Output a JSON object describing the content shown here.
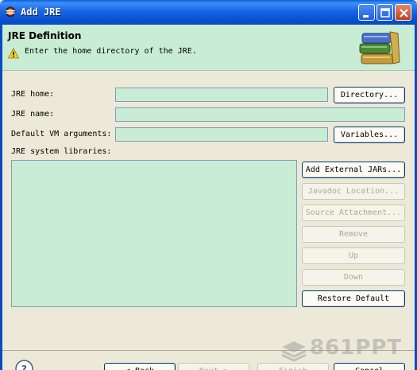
{
  "window": {
    "title": "Add JRE",
    "controls": [
      "minimize",
      "maximize",
      "close"
    ],
    "title_color": "#0a5fe0"
  },
  "banner": {
    "title": "JRE Definition",
    "message": "Enter the home directory of the JRE.",
    "icon": "warning-icon",
    "image": "books-icon",
    "background": "#c8ecd4"
  },
  "form": {
    "jre_home_label": "JRE home:",
    "jre_home_value": "",
    "jre_name_label": "JRE name:",
    "jre_name_value": "",
    "vm_args_label": "Default VM arguments:",
    "vm_args_value": "",
    "libraries_label": "JRE system libraries:",
    "directory_button": "Directory...",
    "variables_button": "Variables..."
  },
  "library_buttons": {
    "add_external": "Add External JARs...",
    "javadoc": "Javadoc Location...",
    "source": "Source Attachment...",
    "remove": "Remove",
    "up": "Up",
    "down": "Down",
    "restore": "Restore Default"
  },
  "footer": {
    "back": "< Back",
    "next": "Next >",
    "finish": "Finish",
    "cancel": "Cancel",
    "help_icon": "help-icon"
  },
  "watermark": "861PPT"
}
